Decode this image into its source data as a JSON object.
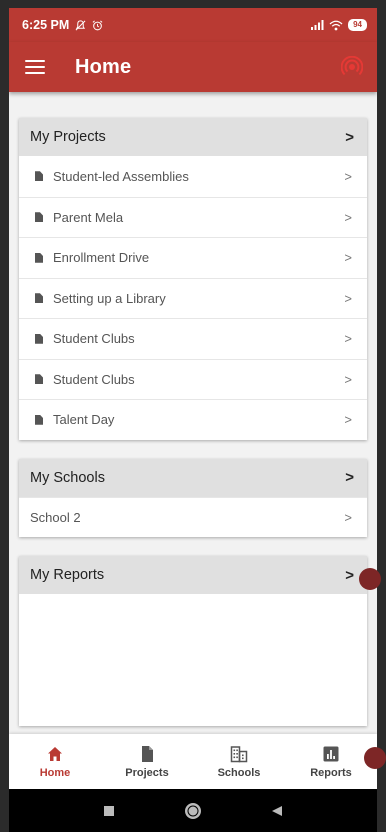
{
  "status_bar": {
    "time": "6:25 PM",
    "battery": "94"
  },
  "app_bar": {
    "title": "Home",
    "menu_icon": "hamburger-menu-icon",
    "action_icon": "live-broadcast-icon"
  },
  "projects": {
    "header": "My Projects",
    "items": [
      {
        "label": "Student-led Assemblies"
      },
      {
        "label": "Parent Mela"
      },
      {
        "label": "Enrollment Drive"
      },
      {
        "label": "Setting up a Library"
      },
      {
        "label": "Student Clubs"
      },
      {
        "label": "Student Clubs"
      },
      {
        "label": "Talent Day"
      }
    ]
  },
  "schools": {
    "header": "My Schools",
    "items": [
      {
        "label": "School 2"
      }
    ]
  },
  "reports": {
    "header": "My Reports"
  },
  "bottom_nav": {
    "items": [
      {
        "label": "Home",
        "icon": "home-icon",
        "active": true
      },
      {
        "label": "Projects",
        "icon": "document-icon",
        "active": false
      },
      {
        "label": "Schools",
        "icon": "building-icon",
        "active": false
      },
      {
        "label": "Reports",
        "icon": "bar-chart-icon",
        "active": false
      }
    ]
  },
  "colors": {
    "primary": "#b93a33",
    "accent_dot": "#7d2626"
  }
}
